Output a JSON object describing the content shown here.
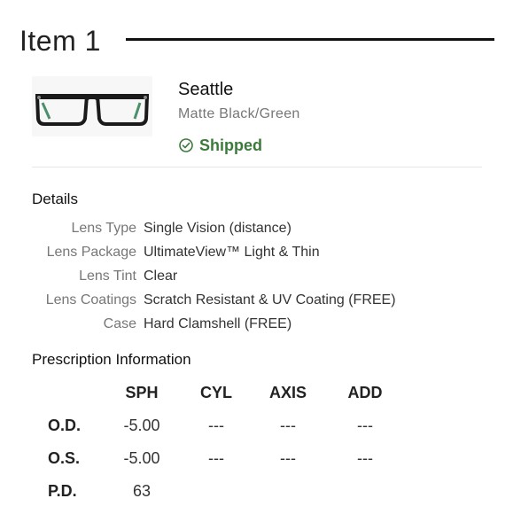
{
  "item": {
    "title": "Item 1"
  },
  "product": {
    "image_icon": "eyeglasses-image",
    "name": "Seattle",
    "color": "Matte Black/Green",
    "status": "Shipped",
    "status_icon": "check-circle-icon",
    "status_color": "#3c7a3c"
  },
  "details": {
    "heading": "Details",
    "rows": [
      {
        "label": "Lens Type",
        "value": "Single Vision (distance)"
      },
      {
        "label": "Lens Package",
        "value": "UltimateView™ Light & Thin"
      },
      {
        "label": "Lens Tint",
        "value": "Clear"
      },
      {
        "label": "Lens Coatings",
        "value": "Scratch Resistant & UV Coating (FREE)"
      },
      {
        "label": "Case",
        "value": "Hard Clamshell (FREE)"
      }
    ]
  },
  "prescription": {
    "heading": "Prescription Information",
    "columns": [
      "SPH",
      "CYL",
      "AXIS",
      "ADD"
    ],
    "rows": [
      {
        "label": "O.D.",
        "values": [
          "-5.00",
          "---",
          "---",
          "---"
        ]
      },
      {
        "label": "O.S.",
        "values": [
          "-5.00",
          "---",
          "---",
          "---"
        ]
      },
      {
        "label": "P.D.",
        "values": [
          "63"
        ]
      }
    ]
  }
}
